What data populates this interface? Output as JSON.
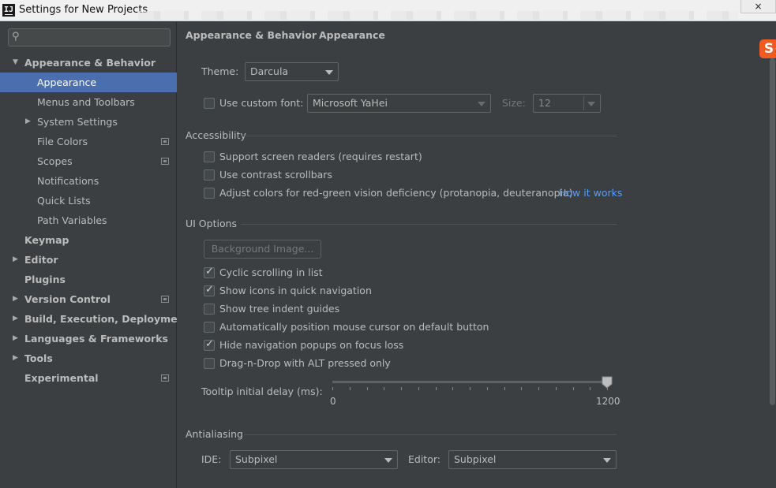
{
  "window": {
    "title": "Settings for New Projects",
    "close_label": "×"
  },
  "search": {
    "placeholder": ""
  },
  "sidebar": {
    "items": [
      {
        "label": "Appearance & Behavior",
        "bold": true,
        "expanded": true,
        "level": 0
      },
      {
        "label": "Appearance",
        "level": 1,
        "selected": true
      },
      {
        "label": "Menus and Toolbars",
        "level": 1
      },
      {
        "label": "System Settings",
        "level": 1,
        "collapsed": true
      },
      {
        "label": "File Colors",
        "level": 1,
        "project_icon": true
      },
      {
        "label": "Scopes",
        "level": 1,
        "project_icon": true
      },
      {
        "label": "Notifications",
        "level": 1
      },
      {
        "label": "Quick Lists",
        "level": 1
      },
      {
        "label": "Path Variables",
        "level": 1
      },
      {
        "label": "Keymap",
        "bold": true,
        "level": 0
      },
      {
        "label": "Editor",
        "bold": true,
        "level": 0,
        "collapsed": true
      },
      {
        "label": "Plugins",
        "bold": true,
        "level": 0
      },
      {
        "label": "Version Control",
        "bold": true,
        "level": 0,
        "collapsed": true,
        "project_icon": true
      },
      {
        "label": "Build, Execution, Deployment",
        "bold": true,
        "level": 0,
        "collapsed": true
      },
      {
        "label": "Languages & Frameworks",
        "bold": true,
        "level": 0,
        "collapsed": true
      },
      {
        "label": "Tools",
        "bold": true,
        "level": 0,
        "collapsed": true
      },
      {
        "label": "Experimental",
        "bold": true,
        "level": 0,
        "project_icon": true
      }
    ]
  },
  "breadcrumb": {
    "parent": "Appearance & Behavior",
    "separator": "›",
    "current": "Appearance"
  },
  "theme": {
    "label": "Theme:",
    "value": "Darcula"
  },
  "custom_font": {
    "label": "Use custom font:",
    "checked": false,
    "font_value": "Microsoft YaHei",
    "size_label": "Size:",
    "size_value": "12"
  },
  "accessibility": {
    "title": "Accessibility",
    "options": [
      {
        "label": "Support screen readers (requires restart)",
        "checked": false
      },
      {
        "label": "Use contrast scrollbars",
        "checked": false
      },
      {
        "label": "Adjust colors for red-green vision deficiency (protanopia, deuteranopia)",
        "checked": false
      }
    ],
    "how_it_works": "How it works"
  },
  "ui_options": {
    "title": "UI Options",
    "background_image_button": "Background Image...",
    "options": [
      {
        "label": "Cyclic scrolling in list",
        "checked": true
      },
      {
        "label": "Show icons in quick navigation",
        "checked": true
      },
      {
        "label": "Show tree indent guides",
        "checked": false
      },
      {
        "label": "Automatically position mouse cursor on default button",
        "checked": false
      },
      {
        "label": "Hide navigation popups on focus loss",
        "checked": true
      },
      {
        "label": "Drag-n-Drop with ALT pressed only",
        "checked": false
      }
    ],
    "tooltip_delay": {
      "label": "Tooltip initial delay (ms):",
      "min_label": "0",
      "max_label": "1200",
      "value": 1200,
      "max": 1200
    }
  },
  "antialiasing": {
    "title": "Antialiasing",
    "ide_label": "IDE:",
    "ide_value": "Subpixel",
    "editor_label": "Editor:",
    "editor_value": "Subpixel"
  },
  "colors": {
    "background": "#3c3f41",
    "selection": "#4b6eaf",
    "link": "#589df6",
    "text": "#bbbbbb"
  }
}
